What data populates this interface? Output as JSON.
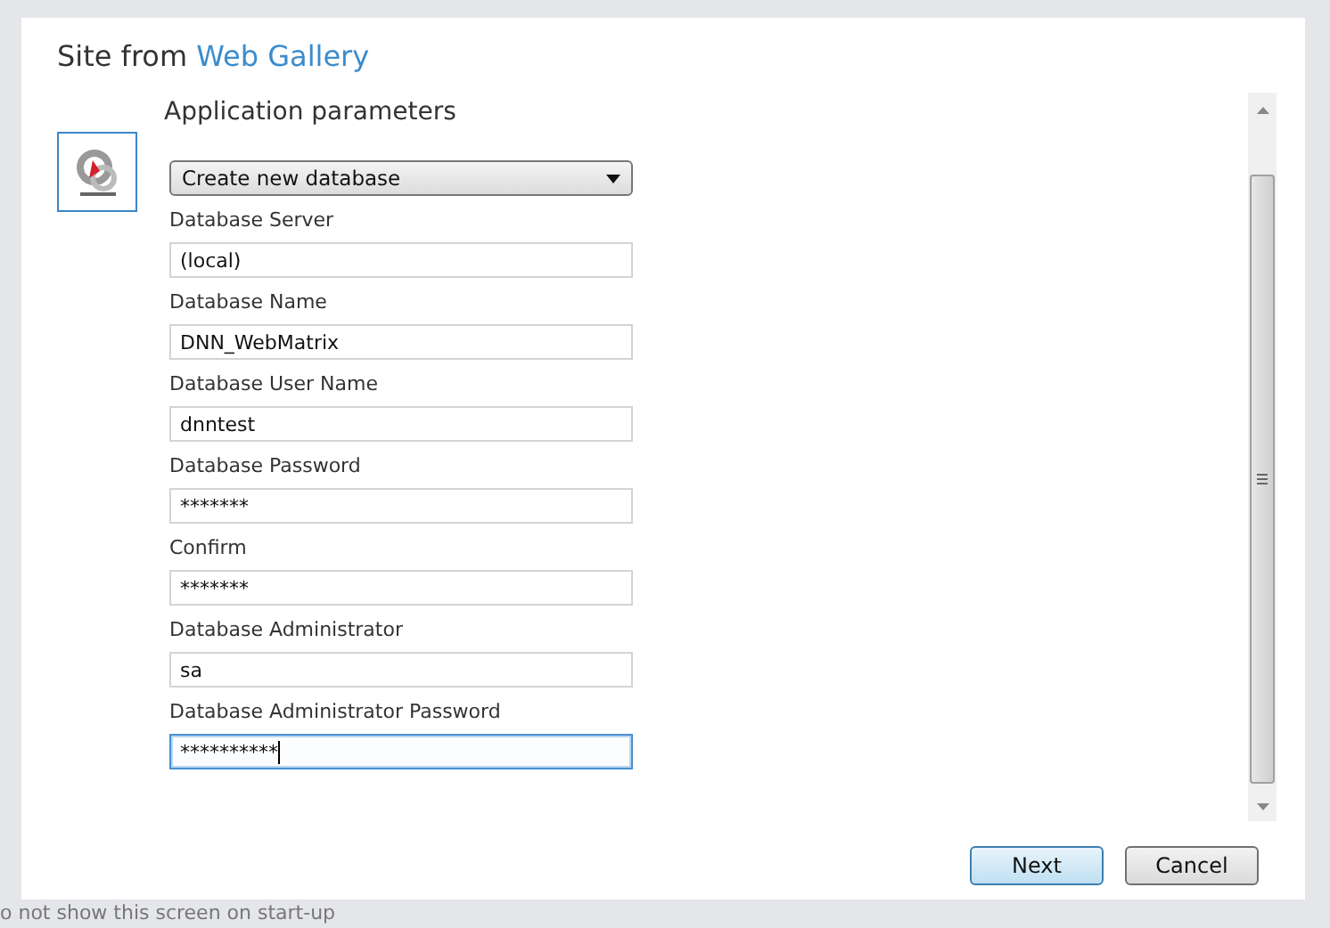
{
  "dialog": {
    "title": "Site from",
    "title_link": "Web Gallery"
  },
  "section_title": "Application parameters",
  "fields": [
    {
      "kind": "select",
      "value": "Create new database"
    },
    {
      "kind": "text",
      "label": "Database Server",
      "value": "(local)",
      "focused": false
    },
    {
      "kind": "text",
      "label": "Database Name",
      "value": "DNN_WebMatrix",
      "focused": false
    },
    {
      "kind": "text",
      "label": "Database User Name",
      "value": "dnntest",
      "focused": false
    },
    {
      "kind": "text",
      "label": "Database Password",
      "value": "*******",
      "focused": false
    },
    {
      "kind": "text",
      "label": "Confirm",
      "value": "*******",
      "focused": false
    },
    {
      "kind": "text",
      "label": "Database Administrator",
      "value": "sa",
      "focused": false
    },
    {
      "kind": "text",
      "label": "Database Administrator Password",
      "value": "**********",
      "focused": true
    }
  ],
  "buttons": [
    {
      "label": "Next",
      "default": true
    },
    {
      "label": "Cancel",
      "default": false
    }
  ],
  "background_text": "o not show this screen on start-up"
}
